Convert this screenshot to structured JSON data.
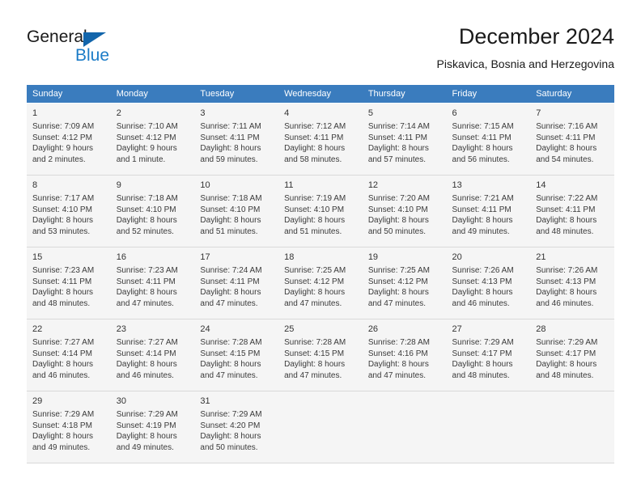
{
  "brand": {
    "word_one": "General",
    "word_two": "Blue",
    "triangle_color": "#1265ab",
    "blue_color": "#1c7cc7"
  },
  "header": {
    "title": "December 2024",
    "subtitle": "Piskavica, Bosnia and Herzegovina"
  },
  "theme": {
    "header_row_bg": "#3a7cbe",
    "shaded_row_bg": "#f5f5f5",
    "grid_line": "#d9d9d9"
  },
  "weekdays": [
    "Sunday",
    "Monday",
    "Tuesday",
    "Wednesday",
    "Thursday",
    "Friday",
    "Saturday"
  ],
  "weeks": [
    {
      "shaded": true,
      "days": [
        {
          "num": "1",
          "sunrise": "Sunrise: 7:09 AM",
          "sunset": "Sunset: 4:12 PM",
          "daylight1": "Daylight: 9 hours",
          "daylight2": "and 2 minutes."
        },
        {
          "num": "2",
          "sunrise": "Sunrise: 7:10 AM",
          "sunset": "Sunset: 4:12 PM",
          "daylight1": "Daylight: 9 hours",
          "daylight2": "and 1 minute."
        },
        {
          "num": "3",
          "sunrise": "Sunrise: 7:11 AM",
          "sunset": "Sunset: 4:11 PM",
          "daylight1": "Daylight: 8 hours",
          "daylight2": "and 59 minutes."
        },
        {
          "num": "4",
          "sunrise": "Sunrise: 7:12 AM",
          "sunset": "Sunset: 4:11 PM",
          "daylight1": "Daylight: 8 hours",
          "daylight2": "and 58 minutes."
        },
        {
          "num": "5",
          "sunrise": "Sunrise: 7:14 AM",
          "sunset": "Sunset: 4:11 PM",
          "daylight1": "Daylight: 8 hours",
          "daylight2": "and 57 minutes."
        },
        {
          "num": "6",
          "sunrise": "Sunrise: 7:15 AM",
          "sunset": "Sunset: 4:11 PM",
          "daylight1": "Daylight: 8 hours",
          "daylight2": "and 56 minutes."
        },
        {
          "num": "7",
          "sunrise": "Sunrise: 7:16 AM",
          "sunset": "Sunset: 4:11 PM",
          "daylight1": "Daylight: 8 hours",
          "daylight2": "and 54 minutes."
        }
      ]
    },
    {
      "shaded": true,
      "days": [
        {
          "num": "8",
          "sunrise": "Sunrise: 7:17 AM",
          "sunset": "Sunset: 4:10 PM",
          "daylight1": "Daylight: 8 hours",
          "daylight2": "and 53 minutes."
        },
        {
          "num": "9",
          "sunrise": "Sunrise: 7:18 AM",
          "sunset": "Sunset: 4:10 PM",
          "daylight1": "Daylight: 8 hours",
          "daylight2": "and 52 minutes."
        },
        {
          "num": "10",
          "sunrise": "Sunrise: 7:18 AM",
          "sunset": "Sunset: 4:10 PM",
          "daylight1": "Daylight: 8 hours",
          "daylight2": "and 51 minutes."
        },
        {
          "num": "11",
          "sunrise": "Sunrise: 7:19 AM",
          "sunset": "Sunset: 4:10 PM",
          "daylight1": "Daylight: 8 hours",
          "daylight2": "and 51 minutes."
        },
        {
          "num": "12",
          "sunrise": "Sunrise: 7:20 AM",
          "sunset": "Sunset: 4:10 PM",
          "daylight1": "Daylight: 8 hours",
          "daylight2": "and 50 minutes."
        },
        {
          "num": "13",
          "sunrise": "Sunrise: 7:21 AM",
          "sunset": "Sunset: 4:11 PM",
          "daylight1": "Daylight: 8 hours",
          "daylight2": "and 49 minutes."
        },
        {
          "num": "14",
          "sunrise": "Sunrise: 7:22 AM",
          "sunset": "Sunset: 4:11 PM",
          "daylight1": "Daylight: 8 hours",
          "daylight2": "and 48 minutes."
        }
      ]
    },
    {
      "shaded": true,
      "days": [
        {
          "num": "15",
          "sunrise": "Sunrise: 7:23 AM",
          "sunset": "Sunset: 4:11 PM",
          "daylight1": "Daylight: 8 hours",
          "daylight2": "and 48 minutes."
        },
        {
          "num": "16",
          "sunrise": "Sunrise: 7:23 AM",
          "sunset": "Sunset: 4:11 PM",
          "daylight1": "Daylight: 8 hours",
          "daylight2": "and 47 minutes."
        },
        {
          "num": "17",
          "sunrise": "Sunrise: 7:24 AM",
          "sunset": "Sunset: 4:11 PM",
          "daylight1": "Daylight: 8 hours",
          "daylight2": "and 47 minutes."
        },
        {
          "num": "18",
          "sunrise": "Sunrise: 7:25 AM",
          "sunset": "Sunset: 4:12 PM",
          "daylight1": "Daylight: 8 hours",
          "daylight2": "and 47 minutes."
        },
        {
          "num": "19",
          "sunrise": "Sunrise: 7:25 AM",
          "sunset": "Sunset: 4:12 PM",
          "daylight1": "Daylight: 8 hours",
          "daylight2": "and 47 minutes."
        },
        {
          "num": "20",
          "sunrise": "Sunrise: 7:26 AM",
          "sunset": "Sunset: 4:13 PM",
          "daylight1": "Daylight: 8 hours",
          "daylight2": "and 46 minutes."
        },
        {
          "num": "21",
          "sunrise": "Sunrise: 7:26 AM",
          "sunset": "Sunset: 4:13 PM",
          "daylight1": "Daylight: 8 hours",
          "daylight2": "and 46 minutes."
        }
      ]
    },
    {
      "shaded": true,
      "days": [
        {
          "num": "22",
          "sunrise": "Sunrise: 7:27 AM",
          "sunset": "Sunset: 4:14 PM",
          "daylight1": "Daylight: 8 hours",
          "daylight2": "and 46 minutes."
        },
        {
          "num": "23",
          "sunrise": "Sunrise: 7:27 AM",
          "sunset": "Sunset: 4:14 PM",
          "daylight1": "Daylight: 8 hours",
          "daylight2": "and 46 minutes."
        },
        {
          "num": "24",
          "sunrise": "Sunrise: 7:28 AM",
          "sunset": "Sunset: 4:15 PM",
          "daylight1": "Daylight: 8 hours",
          "daylight2": "and 47 minutes."
        },
        {
          "num": "25",
          "sunrise": "Sunrise: 7:28 AM",
          "sunset": "Sunset: 4:15 PM",
          "daylight1": "Daylight: 8 hours",
          "daylight2": "and 47 minutes."
        },
        {
          "num": "26",
          "sunrise": "Sunrise: 7:28 AM",
          "sunset": "Sunset: 4:16 PM",
          "daylight1": "Daylight: 8 hours",
          "daylight2": "and 47 minutes."
        },
        {
          "num": "27",
          "sunrise": "Sunrise: 7:29 AM",
          "sunset": "Sunset: 4:17 PM",
          "daylight1": "Daylight: 8 hours",
          "daylight2": "and 48 minutes."
        },
        {
          "num": "28",
          "sunrise": "Sunrise: 7:29 AM",
          "sunset": "Sunset: 4:17 PM",
          "daylight1": "Daylight: 8 hours",
          "daylight2": "and 48 minutes."
        }
      ]
    },
    {
      "shaded": true,
      "days": [
        {
          "num": "29",
          "sunrise": "Sunrise: 7:29 AM",
          "sunset": "Sunset: 4:18 PM",
          "daylight1": "Daylight: 8 hours",
          "daylight2": "and 49 minutes."
        },
        {
          "num": "30",
          "sunrise": "Sunrise: 7:29 AM",
          "sunset": "Sunset: 4:19 PM",
          "daylight1": "Daylight: 8 hours",
          "daylight2": "and 49 minutes."
        },
        {
          "num": "31",
          "sunrise": "Sunrise: 7:29 AM",
          "sunset": "Sunset: 4:20 PM",
          "daylight1": "Daylight: 8 hours",
          "daylight2": "and 50 minutes."
        },
        {
          "num": "",
          "sunrise": "",
          "sunset": "",
          "daylight1": "",
          "daylight2": ""
        },
        {
          "num": "",
          "sunrise": "",
          "sunset": "",
          "daylight1": "",
          "daylight2": ""
        },
        {
          "num": "",
          "sunrise": "",
          "sunset": "",
          "daylight1": "",
          "daylight2": ""
        },
        {
          "num": "",
          "sunrise": "",
          "sunset": "",
          "daylight1": "",
          "daylight2": ""
        }
      ]
    }
  ]
}
